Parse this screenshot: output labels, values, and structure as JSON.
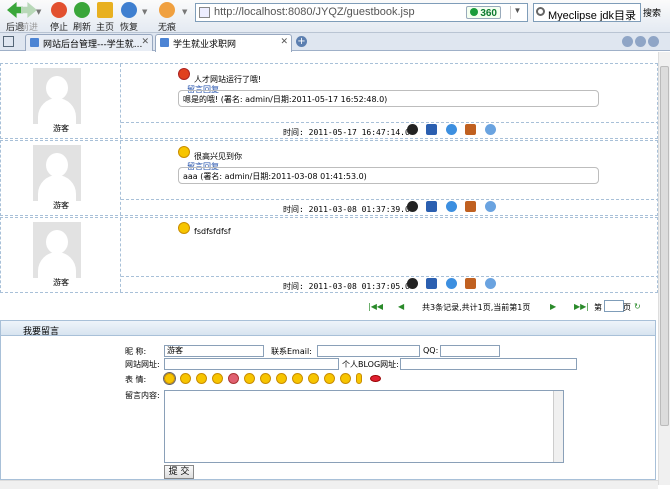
{
  "toolbar": {
    "back": "后退",
    "forward": "前进",
    "stop": "停止",
    "refresh": "刷新",
    "home": "主页",
    "restore": "恢复",
    "notrace": "无痕"
  },
  "address": {
    "url": "http://localhost:8080/JYQZ/guestbook.jsp",
    "brand": "360",
    "dropdown": "▼"
  },
  "search": {
    "value": "Myeclipse jdk目录",
    "button": "搜索"
  },
  "tabs": [
    {
      "label": "网站后台管理---学生就..."
    },
    {
      "label": "学生就业求职网"
    }
  ],
  "entries": [
    {
      "guest": "游客",
      "message": "人才网站运行了哦!",
      "reply_label": "留言回复",
      "reply": "嗯是的哦! (署名: admin/日期:2011-05-17 16:52:48.0)",
      "time": "时间: 2011-05-17 16:47:14.0"
    },
    {
      "guest": "游客",
      "message": "很高兴见到你",
      "reply_label": "留言回复",
      "reply": "aaa (署名: admin/日期:2011-03-08 01:41:53.0)",
      "time": "时间: 2011-03-08 01:37:39.0"
    },
    {
      "guest": "游客",
      "message": "fsdfsfdfsf",
      "time": "时间: 2011-03-08 01:37:05.0"
    }
  ],
  "pager": {
    "summary": "共3条记录,共计1页,当前第1页",
    "page_prefix": "第",
    "page_suffix": "页"
  },
  "form": {
    "title": "我要留言",
    "nick_label": "昵    称:",
    "nick_value": "游客",
    "email_label": "联系Email:",
    "qq_label": "QQ:",
    "site_label": "网站网址:",
    "blog_label": "个人BLOG网址:",
    "face_label": "表    情:",
    "content_label": "留言内容:",
    "submit": "提 交"
  },
  "colors": {
    "accent": "#1a4aa8",
    "footer": "#c00000"
  }
}
